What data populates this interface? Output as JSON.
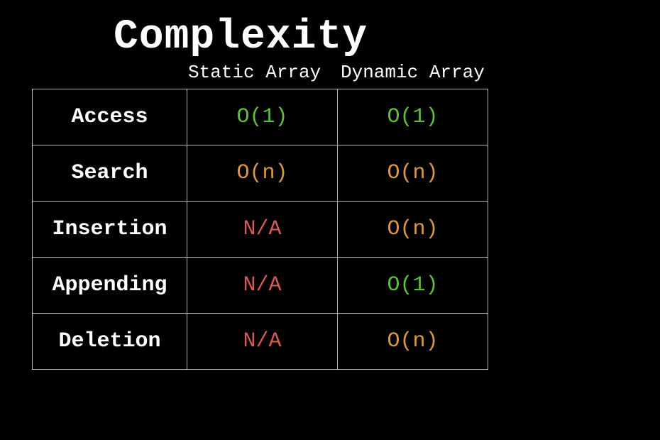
{
  "title": "Complexity",
  "columns": {
    "col1": "Static Array",
    "col2": "Dynamic Array"
  },
  "rows": [
    {
      "label": "Access",
      "static": {
        "value": "O(1)",
        "color": "green"
      },
      "dynamic": {
        "value": "O(1)",
        "color": "green"
      }
    },
    {
      "label": "Search",
      "static": {
        "value": "O(n)",
        "color": "orange"
      },
      "dynamic": {
        "value": "O(n)",
        "color": "orange"
      }
    },
    {
      "label": "Insertion",
      "static": {
        "value": "N/A",
        "color": "red"
      },
      "dynamic": {
        "value": "O(n)",
        "color": "orange"
      }
    },
    {
      "label": "Appending",
      "static": {
        "value": "N/A",
        "color": "red"
      },
      "dynamic": {
        "value": "O(1)",
        "color": "green"
      }
    },
    {
      "label": "Deletion",
      "static": {
        "value": "N/A",
        "color": "red"
      },
      "dynamic": {
        "value": "O(n)",
        "color": "orange"
      }
    }
  ]
}
